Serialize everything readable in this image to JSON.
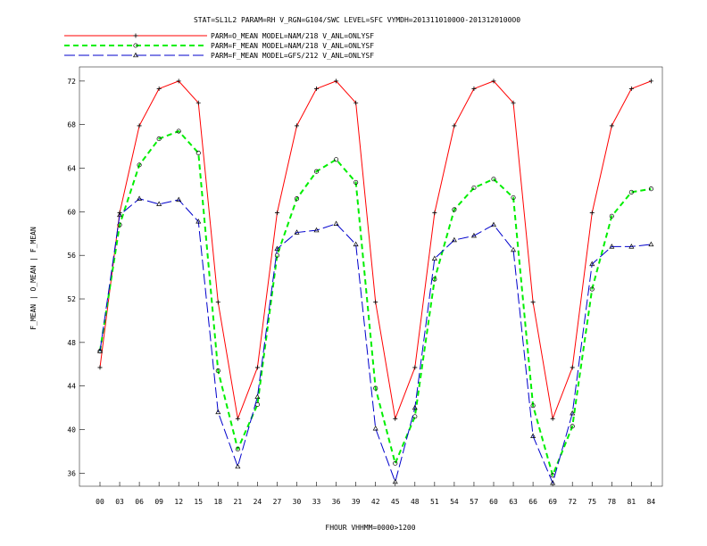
{
  "chart_data": {
    "type": "line",
    "title": "STAT=SL1L2 PARAM=RH V_RGN=G104/SWC LEVEL=SFC VYMDH=2013110100O0-2013120100O0",
    "xlabel": "FHOUR VHHMM=0000>1200",
    "ylabel": "F_MEAN | O_MEAN | F_MEAN",
    "categories": [
      "00",
      "03",
      "06",
      "09",
      "12",
      "15",
      "18",
      "21",
      "24",
      "27",
      "30",
      "33",
      "36",
      "39",
      "42",
      "45",
      "48",
      "51",
      "54",
      "57",
      "60",
      "63",
      "66",
      "69",
      "72",
      "75",
      "78",
      "81",
      "84"
    ],
    "yticks": [
      36,
      40,
      44,
      48,
      52,
      56,
      60,
      64,
      68,
      72
    ],
    "ylim": [
      34.8,
      73.3
    ],
    "grid": false,
    "legend_position": "top",
    "series": [
      {
        "name": "PARM=O_MEAN MODEL=NAM/218 V_ANL=ONLYSF",
        "color": "#ff0000",
        "style": "solid",
        "marker": "plus",
        "values": [
          45.7,
          59.9,
          67.9,
          71.3,
          72.0,
          70.0,
          51.7,
          41.0,
          45.7,
          59.9,
          67.9,
          71.3,
          72.0,
          70.0,
          51.7,
          41.0,
          45.7,
          59.9,
          67.9,
          71.3,
          72.0,
          70.0,
          51.7,
          41.0,
          45.7,
          59.9,
          67.9,
          71.3,
          72.0
        ]
      },
      {
        "name": "PARM=F_MEAN MODEL=NAM/218 V_ANL=ONLYSF",
        "color": "#00ee00",
        "style": "dashed",
        "marker": "circle",
        "values": [
          47.2,
          58.8,
          64.3,
          66.7,
          67.4,
          65.4,
          45.4,
          38.2,
          42.3,
          56.0,
          61.2,
          63.7,
          64.8,
          62.7,
          43.8,
          36.9,
          41.2,
          53.8,
          60.2,
          62.2,
          63.0,
          61.3,
          42.2,
          35.8,
          40.3,
          52.9,
          59.6,
          61.8,
          62.1
        ]
      },
      {
        "name": "PARM=F_MEAN MODEL=GFS/212 V_ANL=ONLYSF",
        "color": "#0000cc",
        "style": "longdash",
        "marker": "triangle",
        "values": [
          47.2,
          59.7,
          61.2,
          60.7,
          61.1,
          59.1,
          41.6,
          36.6,
          43.0,
          56.6,
          58.1,
          58.3,
          58.9,
          57.0,
          40.1,
          35.2,
          42.0,
          55.7,
          57.4,
          57.8,
          58.8,
          56.5,
          39.4,
          35.1,
          41.5,
          55.2,
          56.8,
          56.8,
          57.0
        ]
      }
    ]
  }
}
